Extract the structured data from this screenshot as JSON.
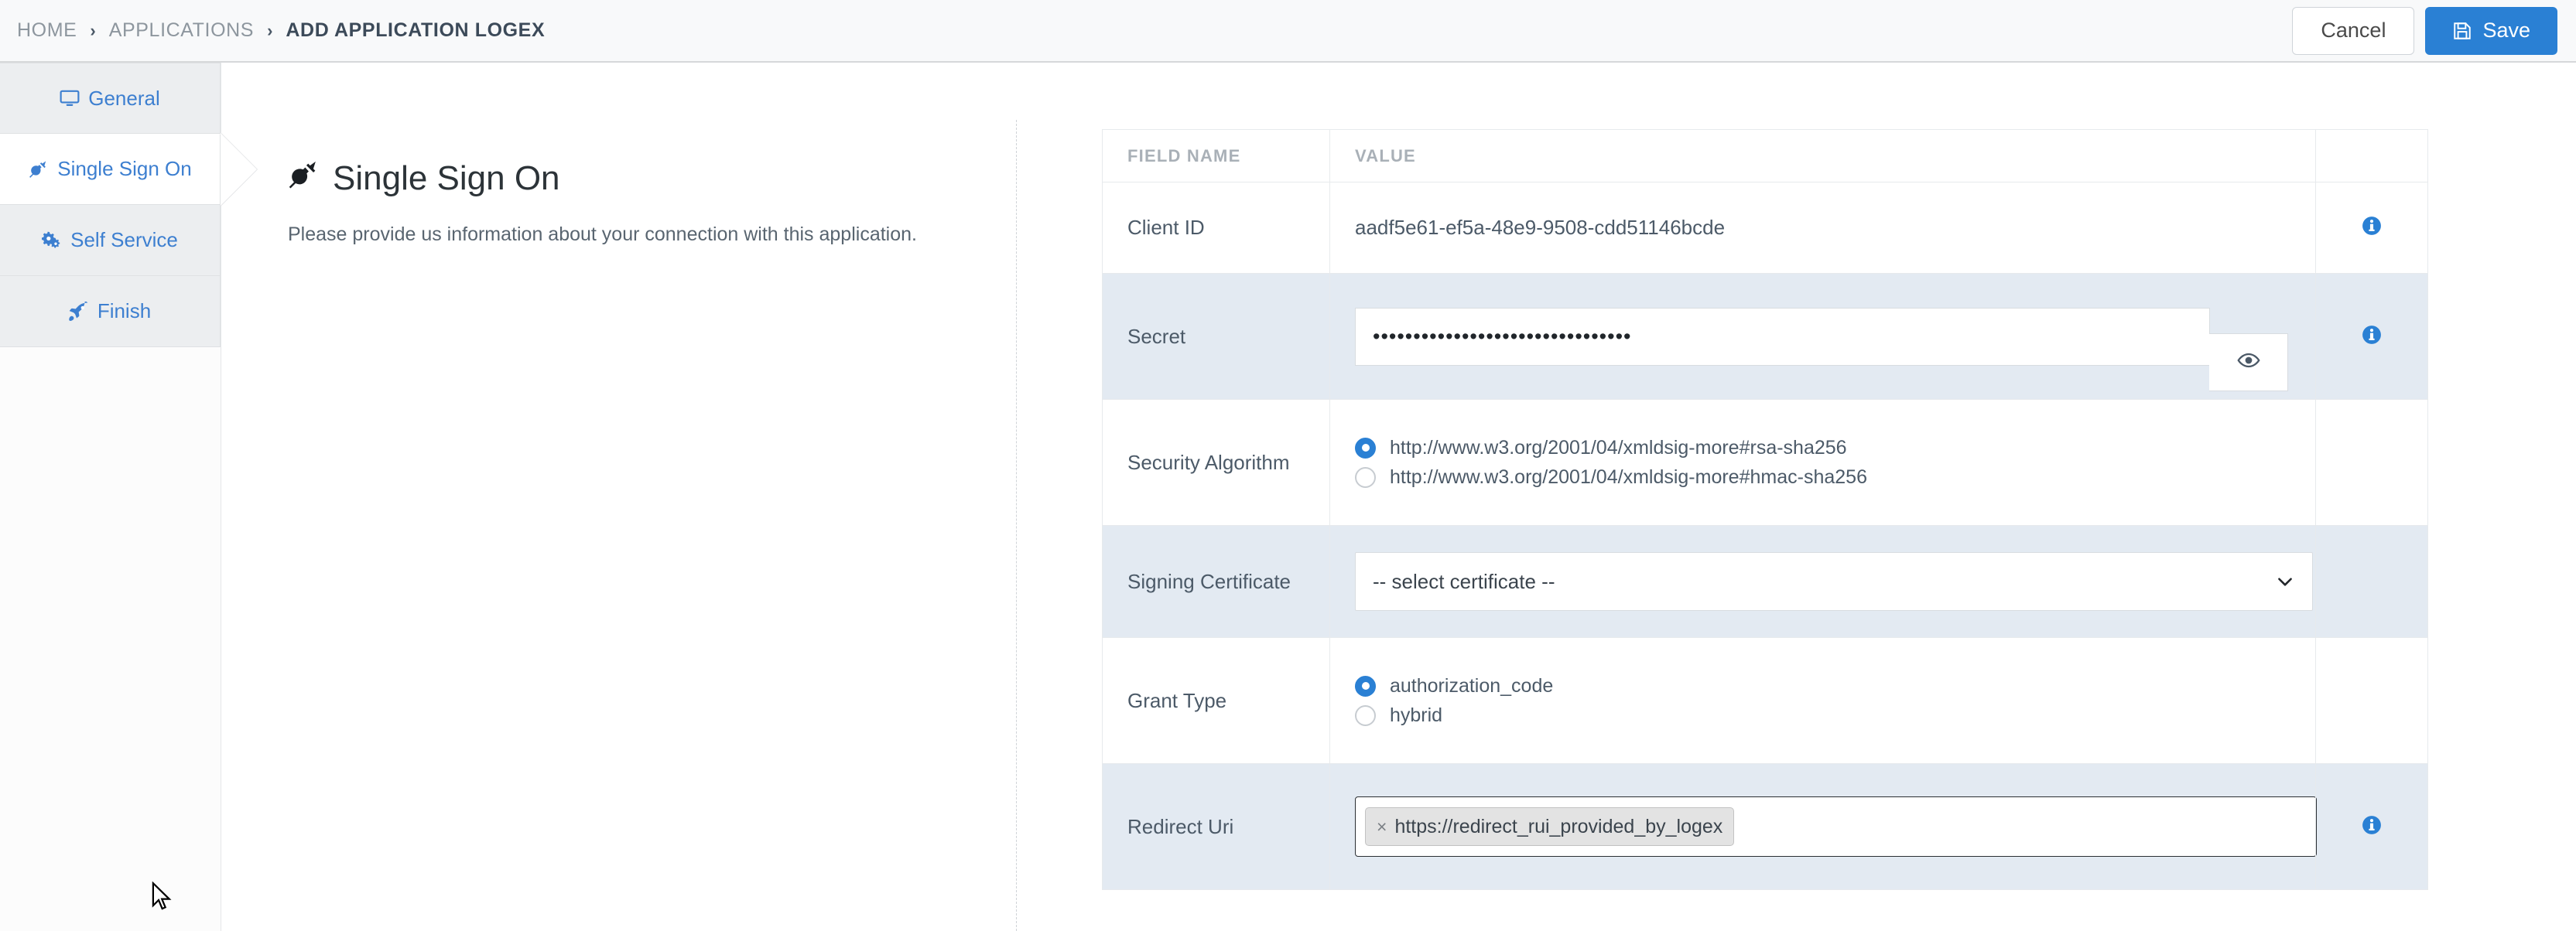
{
  "breadcrumb": {
    "items": [
      {
        "label": "HOME",
        "active": false
      },
      {
        "label": "APPLICATIONS",
        "active": false
      },
      {
        "label": "ADD APPLICATION LOGEX",
        "active": true
      }
    ],
    "separator": "›"
  },
  "toolbar": {
    "cancel_label": "Cancel",
    "save_label": "Save",
    "save_icon": "floppy-disk-icon",
    "accent_color": "#2a80d4"
  },
  "sidebar": {
    "items": [
      {
        "label": "General",
        "icon": "desktop-icon",
        "active": false
      },
      {
        "label": "Single Sign On",
        "icon": "plug-icon",
        "active": true
      },
      {
        "label": "Self Service",
        "icon": "cogs-icon",
        "active": false
      },
      {
        "label": "Finish",
        "icon": "rocket-icon",
        "active": false
      }
    ]
  },
  "main": {
    "title": "Single Sign On",
    "title_icon": "plug-icon",
    "subtitle": "Please provide us information about your connection with this application."
  },
  "table": {
    "headers": [
      "FIELD NAME",
      "VALUE"
    ],
    "rows": [
      {
        "field": "Client ID",
        "type": "text",
        "value": "aadf5e61-ef5a-48e9-9508-cdd51146bcde",
        "info": true,
        "striped": false
      },
      {
        "field": "Secret",
        "type": "password",
        "value": "••••••••••••••••••••••••••••••••",
        "reveal_icon": "eye-icon",
        "info": true,
        "striped": true
      },
      {
        "field": "Security Algorithm",
        "type": "radio",
        "options": [
          {
            "label": "http://www.w3.org/2001/04/xmldsig-more#rsa-sha256",
            "selected": true
          },
          {
            "label": "http://www.w3.org/2001/04/xmldsig-more#hmac-sha256",
            "selected": false
          }
        ],
        "info": false,
        "striped": false
      },
      {
        "field": "Signing Certificate",
        "type": "select",
        "value": "-- select certificate --",
        "caret_icon": "chevron-down-icon",
        "info": false,
        "striped": true
      },
      {
        "field": "Grant Type",
        "type": "radio",
        "options": [
          {
            "label": "authorization_code",
            "selected": true
          },
          {
            "label": "hybrid",
            "selected": false
          }
        ],
        "info": false,
        "striped": false
      },
      {
        "field": "Redirect Uri",
        "type": "tags",
        "tags": [
          "https://redirect_rui_provided_by_logex"
        ],
        "tag_remove_label": "×",
        "info": true,
        "striped": true
      }
    ],
    "info_icon": "info-circle-icon"
  }
}
